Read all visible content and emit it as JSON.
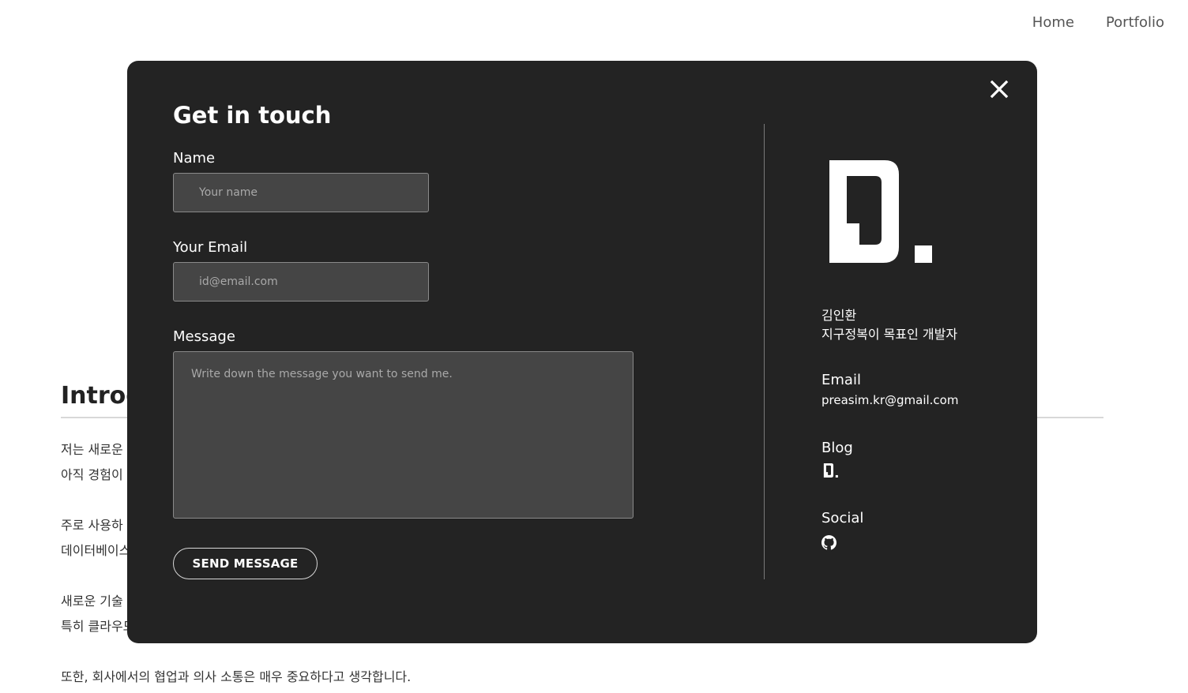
{
  "nav": {
    "items": [
      "Home",
      "Portfolio"
    ]
  },
  "background": {
    "title": "Introd",
    "lines": [
      "저는 새로운",
      "아직 경험이",
      "주로 사용하",
      "데이터베이스",
      "새로운 기술",
      "특히 클라우드",
      "또한, 회사에서의 협업과 의사 소통은 매우 중요하다고 생각합니다."
    ]
  },
  "modal": {
    "title": "Get in touch",
    "form": {
      "name_label": "Name",
      "name_placeholder": "Your name",
      "email_label": "Your Email",
      "email_placeholder": "id@email.com",
      "message_label": "Message",
      "message_placeholder": "Write down the message you want to send me.",
      "submit_label": "SEND MESSAGE"
    },
    "profile": {
      "logo_icon": "d-logo-icon",
      "name": "김인환",
      "tagline": "지구정복이 목표인 개발자",
      "email_heading": "Email",
      "email": "preasim.kr@gmail.com",
      "blog_heading": "Blog",
      "blog_icon": "d-logo-small-icon",
      "social_heading": "Social",
      "social_icon": "github-icon"
    }
  },
  "colors": {
    "modal_bg": "#232323",
    "input_bg": "#454545",
    "input_border": "#8a8a8a",
    "page_bg": "#ffffff",
    "nav_text": "#555555"
  }
}
